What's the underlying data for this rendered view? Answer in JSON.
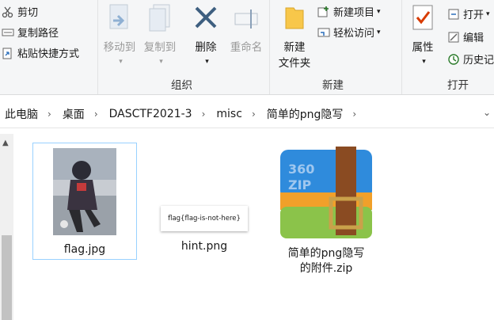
{
  "ribbon": {
    "clipboard": {
      "cut": "剪切",
      "copy_path": "复制路径",
      "paste_shortcut": "粘贴快捷方式"
    },
    "organize": {
      "move_to": "移动到",
      "copy_to": "复制到",
      "delete": "删除",
      "rename": "重命名",
      "label": "组织"
    },
    "new": {
      "new_item": "新建项目",
      "easy_access": "轻松访问",
      "new_folder_line1": "新建",
      "new_folder_line2": "文件夹",
      "label": "新建"
    },
    "open": {
      "properties": "属性",
      "open": "打开",
      "edit": "编辑",
      "history": "历史记",
      "label": "打开"
    }
  },
  "address": {
    "crumbs": [
      "此电脑",
      "桌面",
      "DASCTF2021-3",
      "misc",
      "简单的png隐写"
    ]
  },
  "files": [
    {
      "name": "flag.jpg"
    },
    {
      "name": "hint.png",
      "thumbnail_text": "flag{flag-is-not-here}"
    },
    {
      "name_line1": "简单的png隐写",
      "name_line2": "的附件.zip",
      "badge": "360 ZIP"
    }
  ],
  "colors": {
    "accent": "#0078d7",
    "selection_border": "#99d1ff",
    "folder": "#f8c74a",
    "zip_blue": "#2f8bdc",
    "zip_orange": "#f1a02a",
    "zip_green": "#8bc34a",
    "zip_strap": "#8a4b22"
  }
}
